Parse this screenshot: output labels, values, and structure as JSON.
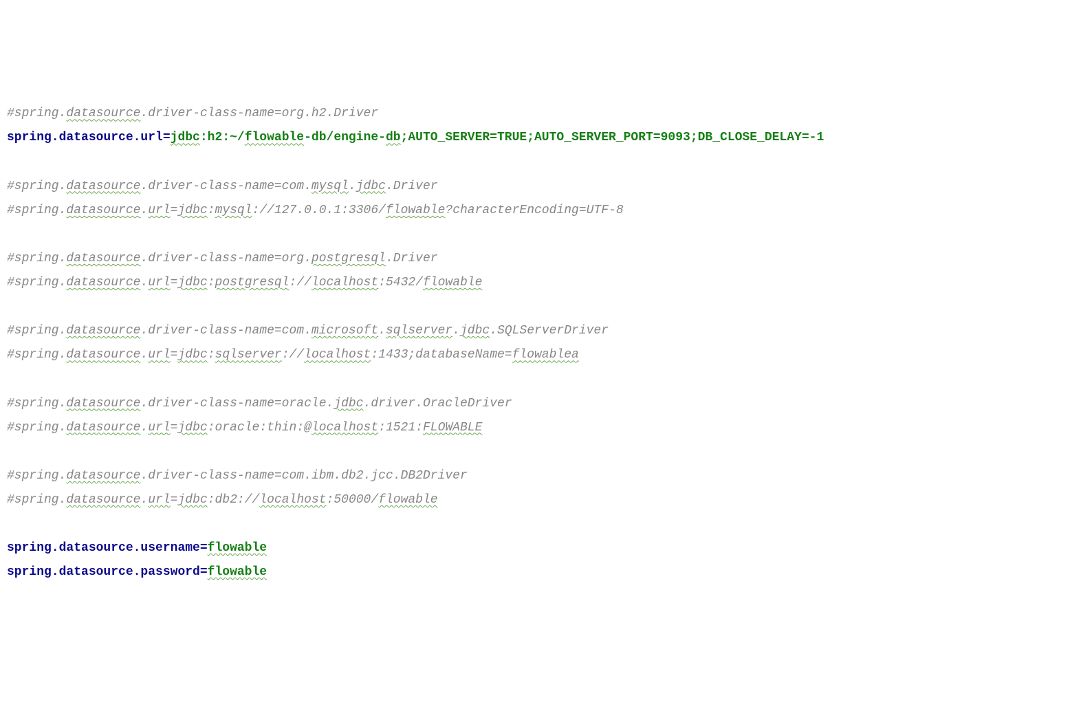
{
  "lines": [
    {
      "type": "comment",
      "parts": [
        {
          "text": "#spring.",
          "cls": ""
        },
        {
          "text": "datasource",
          "cls": "typo"
        },
        {
          "text": ".driver-class-name=org.h2.Driver",
          "cls": ""
        }
      ]
    },
    {
      "type": "kv",
      "key": "spring.datasource.url",
      "valueParts": [
        {
          "text": "jdbc",
          "cls": "typo"
        },
        {
          "text": ":h2:~/",
          "cls": ""
        },
        {
          "text": "flowable",
          "cls": "typo"
        },
        {
          "text": "-db/engine-",
          "cls": ""
        },
        {
          "text": "db",
          "cls": "typo"
        },
        {
          "text": ";AUTO_SERVER=TRUE;AUTO_SERVER_PORT=9093;DB_CLOSE_DELAY=-1",
          "cls": ""
        }
      ]
    },
    {
      "type": "blank"
    },
    {
      "type": "comment",
      "parts": [
        {
          "text": "#spring.",
          "cls": ""
        },
        {
          "text": "datasource",
          "cls": "typo"
        },
        {
          "text": ".driver-class-name=com.",
          "cls": ""
        },
        {
          "text": "mysql",
          "cls": "typo"
        },
        {
          "text": ".",
          "cls": ""
        },
        {
          "text": "jdbc",
          "cls": "typo"
        },
        {
          "text": ".Driver",
          "cls": ""
        }
      ]
    },
    {
      "type": "comment",
      "parts": [
        {
          "text": "#spring.",
          "cls": ""
        },
        {
          "text": "datasource",
          "cls": "typo"
        },
        {
          "text": ".",
          "cls": ""
        },
        {
          "text": "url",
          "cls": "typo"
        },
        {
          "text": "=",
          "cls": ""
        },
        {
          "text": "jdbc",
          "cls": "typo"
        },
        {
          "text": ":",
          "cls": ""
        },
        {
          "text": "mysql",
          "cls": "typo"
        },
        {
          "text": "://127.0.0.1:3306/",
          "cls": ""
        },
        {
          "text": "flowable",
          "cls": "typo"
        },
        {
          "text": "?characterEncoding=UTF-8",
          "cls": ""
        }
      ]
    },
    {
      "type": "blank"
    },
    {
      "type": "comment",
      "parts": [
        {
          "text": "#spring.",
          "cls": ""
        },
        {
          "text": "datasource",
          "cls": "typo"
        },
        {
          "text": ".driver-class-name=org.",
          "cls": ""
        },
        {
          "text": "postgresql",
          "cls": "typo"
        },
        {
          "text": ".Driver",
          "cls": ""
        }
      ]
    },
    {
      "type": "comment",
      "parts": [
        {
          "text": "#spring.",
          "cls": ""
        },
        {
          "text": "datasource",
          "cls": "typo"
        },
        {
          "text": ".",
          "cls": ""
        },
        {
          "text": "url",
          "cls": "typo"
        },
        {
          "text": "=",
          "cls": ""
        },
        {
          "text": "jdbc",
          "cls": "typo"
        },
        {
          "text": ":",
          "cls": ""
        },
        {
          "text": "postgresql",
          "cls": "typo"
        },
        {
          "text": "://",
          "cls": ""
        },
        {
          "text": "localhost",
          "cls": "typo"
        },
        {
          "text": ":5432/",
          "cls": ""
        },
        {
          "text": "flowable",
          "cls": "typo"
        }
      ]
    },
    {
      "type": "blank"
    },
    {
      "type": "comment",
      "parts": [
        {
          "text": "#spring.",
          "cls": ""
        },
        {
          "text": "datasource",
          "cls": "typo"
        },
        {
          "text": ".driver-class-name=com.",
          "cls": ""
        },
        {
          "text": "microsoft",
          "cls": "typo"
        },
        {
          "text": ".",
          "cls": ""
        },
        {
          "text": "sqlserver",
          "cls": "typo"
        },
        {
          "text": ".",
          "cls": ""
        },
        {
          "text": "jdbc",
          "cls": "typo"
        },
        {
          "text": ".SQLServerDriver",
          "cls": ""
        }
      ]
    },
    {
      "type": "comment",
      "parts": [
        {
          "text": "#spring.",
          "cls": ""
        },
        {
          "text": "datasource",
          "cls": "typo"
        },
        {
          "text": ".",
          "cls": ""
        },
        {
          "text": "url",
          "cls": "typo"
        },
        {
          "text": "=",
          "cls": ""
        },
        {
          "text": "jdbc",
          "cls": "typo"
        },
        {
          "text": ":",
          "cls": ""
        },
        {
          "text": "sqlserver",
          "cls": "typo"
        },
        {
          "text": "://",
          "cls": ""
        },
        {
          "text": "localhost",
          "cls": "typo"
        },
        {
          "text": ":1433;databaseName=",
          "cls": ""
        },
        {
          "text": "flowablea",
          "cls": "typo"
        }
      ]
    },
    {
      "type": "blank"
    },
    {
      "type": "comment",
      "parts": [
        {
          "text": "#spring.",
          "cls": ""
        },
        {
          "text": "datasource",
          "cls": "typo"
        },
        {
          "text": ".driver-class-name=oracle.",
          "cls": ""
        },
        {
          "text": "jdbc",
          "cls": "typo"
        },
        {
          "text": ".driver.OracleDriver",
          "cls": ""
        }
      ]
    },
    {
      "type": "comment",
      "parts": [
        {
          "text": "#spring.",
          "cls": ""
        },
        {
          "text": "datasource",
          "cls": "typo"
        },
        {
          "text": ".",
          "cls": ""
        },
        {
          "text": "url",
          "cls": "typo"
        },
        {
          "text": "=",
          "cls": ""
        },
        {
          "text": "jdbc",
          "cls": "typo"
        },
        {
          "text": ":oracle:thin:@",
          "cls": ""
        },
        {
          "text": "localhost",
          "cls": "typo"
        },
        {
          "text": ":1521:",
          "cls": ""
        },
        {
          "text": "FLOWABLE",
          "cls": "typo"
        }
      ]
    },
    {
      "type": "blank"
    },
    {
      "type": "comment",
      "parts": [
        {
          "text": "#spring.",
          "cls": ""
        },
        {
          "text": "datasource",
          "cls": "typo"
        },
        {
          "text": ".driver-class-name=com.ibm.db2.jcc.DB2Driver",
          "cls": ""
        }
      ]
    },
    {
      "type": "comment",
      "parts": [
        {
          "text": "#spring.",
          "cls": ""
        },
        {
          "text": "datasource",
          "cls": "typo"
        },
        {
          "text": ".",
          "cls": ""
        },
        {
          "text": "url",
          "cls": "typo"
        },
        {
          "text": "=",
          "cls": ""
        },
        {
          "text": "jdbc",
          "cls": "typo"
        },
        {
          "text": ":db2://",
          "cls": ""
        },
        {
          "text": "localhost",
          "cls": "typo"
        },
        {
          "text": ":50000/",
          "cls": ""
        },
        {
          "text": "flowable",
          "cls": "typo"
        }
      ]
    },
    {
      "type": "blank"
    },
    {
      "type": "kv",
      "key": "spring.datasource.username",
      "valueParts": [
        {
          "text": "flowable",
          "cls": "typo"
        }
      ]
    },
    {
      "type": "kv",
      "key": "spring.datasource.password",
      "valueParts": [
        {
          "text": "flowable",
          "cls": "typo"
        }
      ]
    }
  ]
}
